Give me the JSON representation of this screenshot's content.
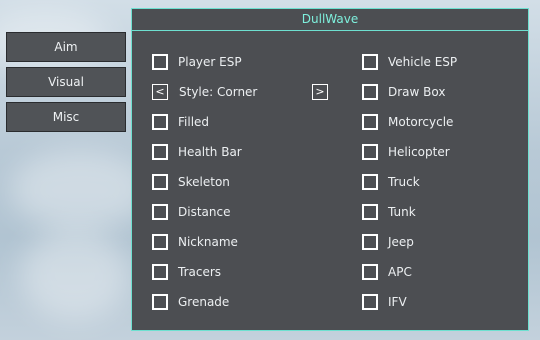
{
  "sidebar": {
    "items": [
      {
        "label": "Aim"
      },
      {
        "label": "Visual"
      },
      {
        "label": "Misc"
      }
    ]
  },
  "panel": {
    "title": "DullWave",
    "style_selector": {
      "prev_label": "<",
      "next_label": ">",
      "value": "Style: Corner"
    },
    "left_options": [
      {
        "label": "Player ESP",
        "checked": false
      },
      {
        "label": "Filled",
        "checked": false
      },
      {
        "label": "Health Bar",
        "checked": false
      },
      {
        "label": "Skeleton",
        "checked": false
      },
      {
        "label": "Distance",
        "checked": false
      },
      {
        "label": "Nickname",
        "checked": false
      },
      {
        "label": "Tracers",
        "checked": false
      },
      {
        "label": "Grenade",
        "checked": false
      }
    ],
    "right_options": [
      {
        "label": "Vehicle ESP",
        "checked": false
      },
      {
        "label": "Draw Box",
        "checked": false
      },
      {
        "label": "Motorcycle",
        "checked": false
      },
      {
        "label": "Helicopter",
        "checked": false
      },
      {
        "label": "Truck",
        "checked": false
      },
      {
        "label": "Tunk",
        "checked": false
      },
      {
        "label": "Jeep",
        "checked": false
      },
      {
        "label": "APC",
        "checked": false
      },
      {
        "label": "IFV",
        "checked": false
      }
    ]
  },
  "colors": {
    "accent": "#6ee0d0",
    "panel_bg": "#4c4e52",
    "button_bg": "#505357"
  }
}
